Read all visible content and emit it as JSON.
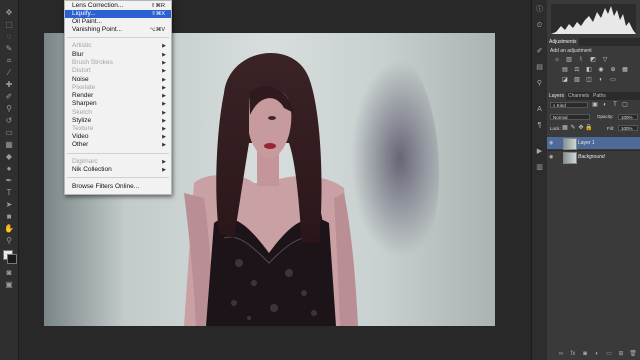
{
  "filter_menu": {
    "items": [
      {
        "label": "Lens Correction...",
        "shortcut": "⇧⌘R",
        "state": "normal"
      },
      {
        "label": "Liquify...",
        "shortcut": "⇧⌘X",
        "state": "highlighted"
      },
      {
        "label": "Oil Paint...",
        "shortcut": "",
        "state": "normal"
      },
      {
        "label": "Vanishing Point...",
        "shortcut": "⌥⌘V",
        "state": "normal"
      },
      {
        "label": "Artistic",
        "submenu": true,
        "state": "disabled"
      },
      {
        "label": "Blur",
        "submenu": true,
        "state": "normal"
      },
      {
        "label": "Brush Strokes",
        "submenu": true,
        "state": "disabled"
      },
      {
        "label": "Distort",
        "submenu": true,
        "state": "disabled"
      },
      {
        "label": "Noise",
        "submenu": true,
        "state": "normal"
      },
      {
        "label": "Pixelate",
        "submenu": true,
        "state": "disabled"
      },
      {
        "label": "Render",
        "submenu": true,
        "state": "normal"
      },
      {
        "label": "Sharpen",
        "submenu": true,
        "state": "normal"
      },
      {
        "label": "Sketch",
        "submenu": true,
        "state": "disabled"
      },
      {
        "label": "Stylize",
        "submenu": true,
        "state": "normal"
      },
      {
        "label": "Texture",
        "submenu": true,
        "state": "disabled"
      },
      {
        "label": "Video",
        "submenu": true,
        "state": "normal"
      },
      {
        "label": "Other",
        "submenu": true,
        "state": "normal"
      },
      {
        "label": "Digimarc",
        "submenu": true,
        "state": "disabled"
      },
      {
        "label": "Nik Collection",
        "submenu": true,
        "state": "normal"
      },
      {
        "label": "Browse Filters Online...",
        "submenu": false,
        "state": "normal"
      }
    ],
    "submenu_arrow": "▶"
  },
  "adjustments_panel": {
    "tab": "Adjustments",
    "prompt": "Add an adjustment"
  },
  "layers_panel": {
    "tabs": [
      "Layers",
      "Channels",
      "Paths"
    ],
    "kind_label": "Kind",
    "blend_mode": "Normal",
    "opacity_label": "Opacity:",
    "opacity_value": "100%",
    "lock_label": "Lock:",
    "fill_label": "Fill:",
    "fill_value": "100%",
    "layers": [
      {
        "name": "Layer 1",
        "selected": true
      },
      {
        "name": "Background",
        "selected": false
      }
    ]
  },
  "colors": {
    "menu_highlight": "#2a63d1",
    "panel_bg": "#3a3a3a",
    "canvas_bg": "#282828"
  }
}
